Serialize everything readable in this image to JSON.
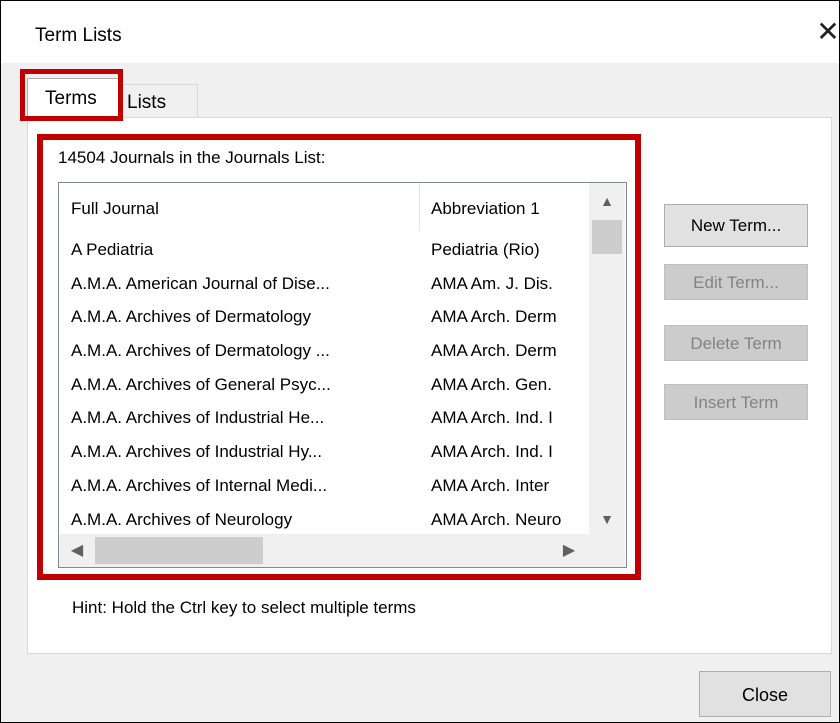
{
  "window": {
    "title": "Term Lists",
    "close_glyph": "✕"
  },
  "tabs": [
    {
      "label": "Terms",
      "selected": true
    },
    {
      "label": "Lists",
      "selected": false
    }
  ],
  "terms_panel": {
    "count_label": "14504 Journals in the Journals List:",
    "columns": [
      "Full Journal",
      "Abbreviation 1"
    ],
    "rows": [
      [
        "A Pediatria",
        "Pediatria (Rio)"
      ],
      [
        "A.M.A. American Journal of Dise...",
        "AMA Am. J. Dis."
      ],
      [
        "A.M.A. Archives of Dermatology",
        "AMA Arch. Derm"
      ],
      [
        "A.M.A. Archives of Dermatology ...",
        "AMA Arch. Derm"
      ],
      [
        "A.M.A. Archives of General Psyc...",
        "AMA Arch. Gen."
      ],
      [
        "A.M.A. Archives of Industrial He...",
        "AMA Arch. Ind. I"
      ],
      [
        "A.M.A. Archives of Industrial Hy...",
        "AMA Arch. Ind. I"
      ],
      [
        "A.M.A. Archives of Internal Medi...",
        "AMA Arch. Inter"
      ],
      [
        "A.M.A. Archives of Neurology",
        "AMA Arch. Neuro"
      ]
    ],
    "scroll_glyphs": {
      "up": "▲",
      "down": "▼",
      "left": "◀",
      "right": "▶"
    }
  },
  "buttons": {
    "new_term": "New Term...",
    "edit_term": "Edit Term...",
    "delete_term": "Delete Term",
    "insert_term": "Insert Term",
    "close": "Close"
  },
  "hint": "Hint: Hold the Ctrl key to select multiple terms",
  "colors": {
    "highlight": "#c00000",
    "disabled_text": "#838383",
    "button_face": "#e1e1e1"
  }
}
